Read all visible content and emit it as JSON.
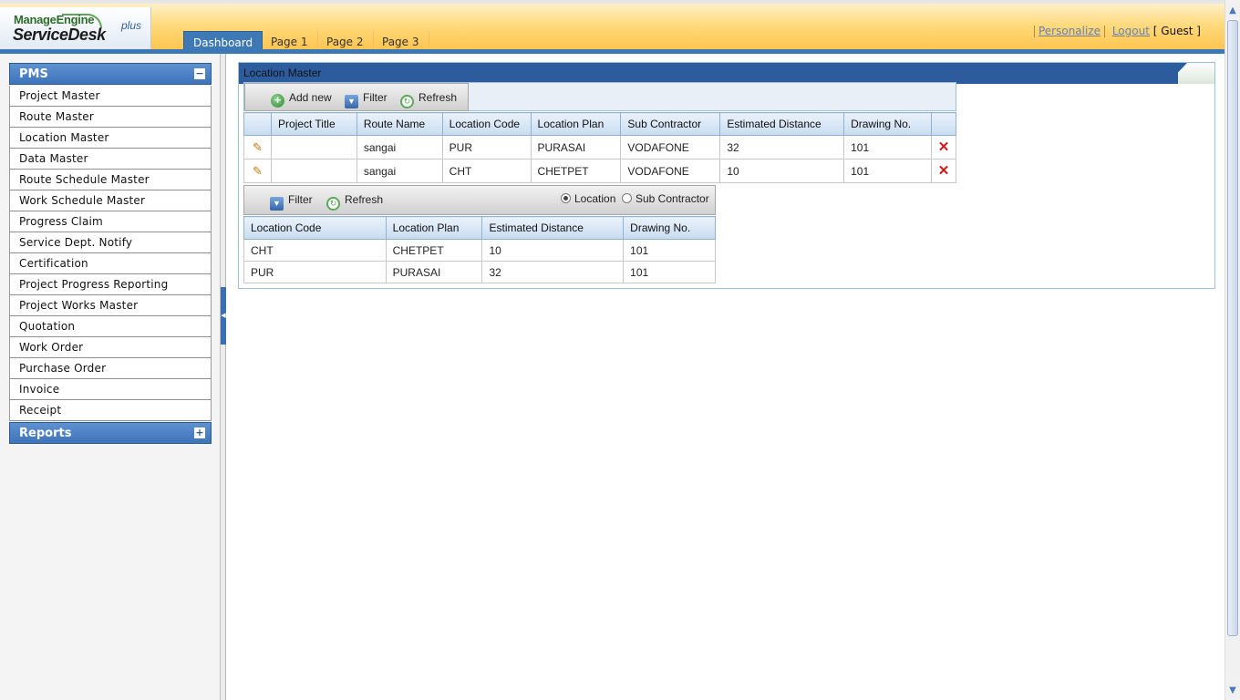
{
  "app": {
    "logo_top": "ManageEngine",
    "logo_main": "ServiceDesk",
    "logo_plus": "plus"
  },
  "tabs": [
    {
      "label": "Dashboard",
      "active": true
    },
    {
      "label": "Page 1",
      "active": false
    },
    {
      "label": "Page 2",
      "active": false
    },
    {
      "label": "Page 3",
      "active": false
    }
  ],
  "top_links": {
    "personalize": "Personalize",
    "logout": "Logout",
    "user": "[ Guest ]"
  },
  "sidebar": {
    "pms_title": "PMS",
    "pms_toggle": "−",
    "items": [
      {
        "label": "Project Master"
      },
      {
        "label": "Route Master"
      },
      {
        "label": "Location Master"
      },
      {
        "label": "Data Master"
      },
      {
        "label": "Route Schedule Master"
      },
      {
        "label": "Work Schedule Master"
      },
      {
        "label": "Progress Claim"
      },
      {
        "label": "Service Dept. Notify"
      },
      {
        "label": "Certification"
      },
      {
        "label": "Project Progress Reporting"
      },
      {
        "label": "Project Works Master"
      },
      {
        "label": "Quotation"
      },
      {
        "label": "Work Order"
      },
      {
        "label": "Purchase Order"
      },
      {
        "label": "Invoice"
      },
      {
        "label": "Receipt"
      }
    ],
    "reports_title": "Reports",
    "reports_toggle": "+"
  },
  "panel": {
    "title": "Location Master",
    "toolbar": {
      "add_new": "Add new",
      "filter": "Filter",
      "refresh": "Refresh"
    },
    "main_table": {
      "columns": [
        "Project Title",
        "Route Name",
        "Location Code",
        "Location Plan",
        "Sub Contractor",
        "Estimated Distance",
        "Drawing No."
      ],
      "rows": [
        {
          "project_title": "",
          "route_name": "sangai",
          "location_code": "PUR",
          "location_plan": "PURASAI",
          "sub_contractor": "VODAFONE",
          "estimated_distance": "32",
          "drawing_no": "101"
        },
        {
          "project_title": "",
          "route_name": "sangai",
          "location_code": "CHT",
          "location_plan": "CHETPET",
          "sub_contractor": "VODAFONE",
          "estimated_distance": "10",
          "drawing_no": "101"
        }
      ]
    },
    "sub_toolbar": {
      "filter": "Filter",
      "refresh": "Refresh",
      "radio_location": "Location",
      "radio_sub_contractor": "Sub Contractor",
      "selected": "Location"
    },
    "sub_table": {
      "columns": [
        "Location Code",
        "Location Plan",
        "Estimated Distance",
        "Drawing No."
      ],
      "rows": [
        {
          "location_code": "CHT",
          "location_plan": "CHETPET",
          "estimated_distance": "10",
          "drawing_no": "101"
        },
        {
          "location_code": "PUR",
          "location_plan": "PURASAI",
          "estimated_distance": "32",
          "drawing_no": "101"
        }
      ]
    }
  },
  "icons": {
    "edit": "pencil-icon",
    "delete": "delete-x-icon",
    "add": "add-circle-icon",
    "filter": "filter-icon",
    "refresh": "refresh-icon"
  },
  "colors": {
    "header_orange": "#ffc24a",
    "nav_blue": "#3e74bb",
    "panel_title_blue": "#2c5c9e",
    "delete_red": "#d01818"
  }
}
